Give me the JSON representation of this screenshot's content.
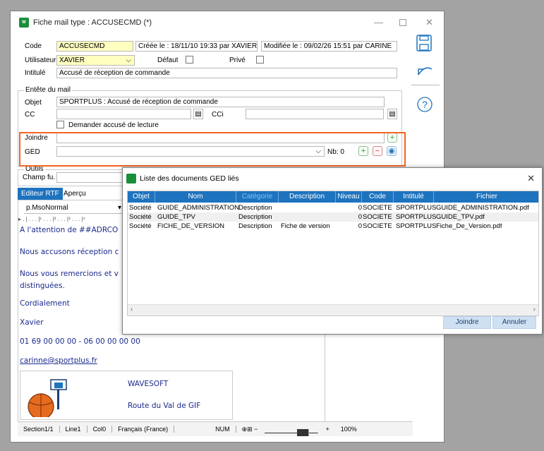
{
  "window": {
    "title": "Fiche mail type : ACCUSECMD (*)",
    "app_icon_text": "W"
  },
  "form": {
    "code_label": "Code",
    "code_value": "ACCUSECMD",
    "created": "Créée le : 18/11/10 19:33 par XAVIER",
    "modified": "Modifiée le : 09/02/26 15:51 par CARINE",
    "user_label": "Utilisateur",
    "user_value": "XAVIER",
    "default_label": "Défaut",
    "private_label": "Privé",
    "intitule_label": "Intitulé",
    "intitule_value": "Accusé de réception de commande"
  },
  "header_section": {
    "legend": "Entête du mail",
    "objet_label": "Objet",
    "objet_value": "SPORTPLUS : Accusé de réception de commande",
    "cc_label": "CC",
    "cci_label": "CCi",
    "accuse_label": "Demander accusé de lecture",
    "joindre_label": "Joindre",
    "ged_label": "GED",
    "nb_label": "Nb: 0"
  },
  "outils_section": {
    "legend": "Outils",
    "champ_label": "Champ fu."
  },
  "editor": {
    "tab_rtf": "Editeur RTF",
    "tab_apercu": "Aperçu",
    "style_value": "p.MsoNormal",
    "lines": [
      "A l'attention de ##ADRCO",
      "Nous accusons réception c",
      "Nous vous remercions et v",
      "distinguées.",
      "Cordialement",
      "Xavier",
      "01 69 00 00 00 - 06 00 00 00 00",
      "carinne@sportplus.fr"
    ],
    "table_line1": "WAVESOFT",
    "table_line2": "Route du Val de GIF"
  },
  "statusbar": {
    "section": "Section1/1",
    "line": "Line1",
    "col": "Col0",
    "lang": "Français (France)",
    "num": "NUM",
    "zoom": "100%"
  },
  "dialog": {
    "title": "Liste des documents GED liés",
    "columns": [
      "Objet",
      "Nom",
      "Catégorie",
      "Description",
      "Niveau",
      "Code",
      "Intitulé",
      "Fichier"
    ],
    "rows": [
      [
        "Société",
        "GUIDE_ADMINISTRATION",
        "Description",
        "",
        "0",
        "SOCIETE",
        "SPORTPLUS",
        "GUIDE_ADMINISTRATION.pdf"
      ],
      [
        "Société",
        "GUIDE_TPV",
        "Description",
        "",
        "0",
        "SOCIETE",
        "SPORTPLUS",
        "GUIDE_TPV.pdf"
      ],
      [
        "Société",
        "FICHE_DE_VERSION",
        "Description",
        "Fiche de version",
        "0",
        "SOCIETE",
        "SPORTPLUS",
        "Fiche_De_Version.pdf"
      ]
    ],
    "join_button": "Joindre",
    "cancel_button": "Annuler"
  },
  "colors": {
    "accent": "#1e73be",
    "highlight": "#f26522",
    "code_bg": "#ffffc0"
  }
}
